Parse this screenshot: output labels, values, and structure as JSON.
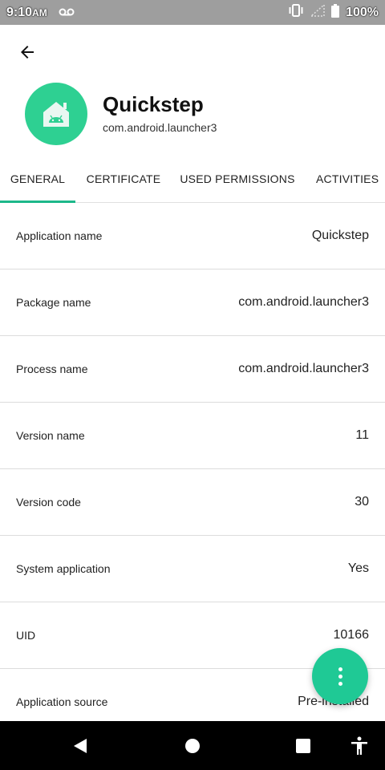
{
  "status_bar": {
    "time": "9:10",
    "am_pm": "AM",
    "battery": "100%",
    "icons": [
      "voicemail-icon",
      "vibrate-icon",
      "signal-icon",
      "battery-icon"
    ]
  },
  "app": {
    "name": "Quickstep",
    "package": "com.android.launcher3",
    "icon": "android-home-icon",
    "accent_color": "#2ed092"
  },
  "tabs": [
    {
      "label": "GENERAL",
      "active": true
    },
    {
      "label": "CERTIFICATE",
      "active": false
    },
    {
      "label": "USED PERMISSIONS",
      "active": false
    },
    {
      "label": "ACTIVITIES",
      "active": false
    }
  ],
  "details": [
    {
      "label": "Application name",
      "value": "Quickstep"
    },
    {
      "label": "Package name",
      "value": "com.android.launcher3"
    },
    {
      "label": "Process name",
      "value": "com.android.launcher3"
    },
    {
      "label": "Version name",
      "value": "11"
    },
    {
      "label": "Version code",
      "value": "30"
    },
    {
      "label": "System application",
      "value": "Yes"
    },
    {
      "label": "UID",
      "value": "10166"
    },
    {
      "label": "Application source",
      "value": "Pre-installed"
    }
  ],
  "fab": {
    "icon": "more-vert-icon"
  },
  "nav": {
    "back": "back-icon",
    "home": "home-icon",
    "recents": "recents-icon",
    "accessibility": "accessibility-icon"
  }
}
